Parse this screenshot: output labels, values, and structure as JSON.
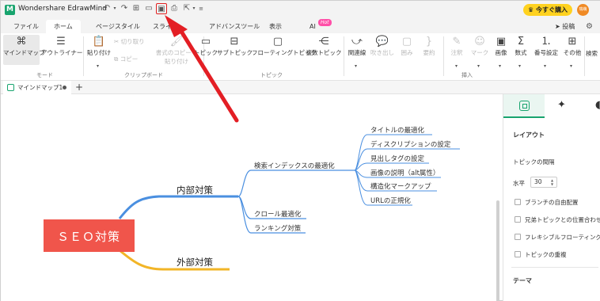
{
  "app": {
    "name": "Wondershare EdrawMind",
    "buy_label": "今すぐ購入",
    "user_initials": "瑞萌"
  },
  "tabs": [
    "ファイル",
    "ホーム",
    "ページスタイル",
    "スライド",
    "アドバンスツール",
    "表示",
    "AI"
  ],
  "hot_badge": "Hot",
  "post_label": "投稿",
  "ribbon": {
    "mindmap": "マインドマップ",
    "outliner": "アウトライナー",
    "paste": "貼り付け",
    "cut": "切り取り",
    "copy": "コピー",
    "format_copy_line1": "書式のコピー・",
    "format_copy_line2": "貼り付け",
    "topic": "トピック",
    "subtopic": "サブトピック",
    "floating_topic": "フローティングトピック",
    "multi_topic": "複数トピック",
    "relation": "関連線",
    "callout": "吹き出し",
    "boundary": "囲み",
    "summary": "要約",
    "note": "注釈",
    "mark": "マーク",
    "image": "画像",
    "formula": "数式",
    "numbering": "番号設定",
    "other": "その他",
    "search": "検索",
    "group_mode": "モード",
    "group_clipboard": "クリップボード",
    "group_topic": "トピック",
    "group_insert": "挿入"
  },
  "doc_tab": "マインドマップ1",
  "mindmap": {
    "root": "ＳＥＯ対策",
    "branch_internal": "内部対策",
    "branch_external": "外部対策",
    "sub_index": "検索インデックスの最適化",
    "sub_crawl": "クロール最適化",
    "sub_ranking": "ランキング対策",
    "leaves": [
      "タイトルの最適化",
      "ディスクリプションの設定",
      "見出しタグの設定",
      "画像の説明（alt属性）",
      "構造化マークアップ",
      "URLの正規化"
    ]
  },
  "panel": {
    "layout": "レイアウト",
    "topic_spacing": "トピックの間隔",
    "horizontal": "水平",
    "horizontal_value": "30",
    "check_branch_free": "ブランチの自由配置",
    "check_sibling_align": "兄弟トピックとの位置合わせ",
    "check_flexible_floating": "フレキシブルフローティングトピック",
    "check_topic_overlap": "トピックの重複",
    "theme": "テーマ"
  },
  "colors": {
    "accent": "#18a46e",
    "root_fill": "#f0554b",
    "internal_line": "#4a8fe0",
    "external_line": "#f2b527",
    "arrow": "#e31e24"
  }
}
